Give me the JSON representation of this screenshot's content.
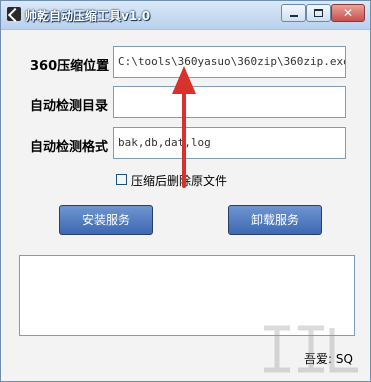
{
  "window": {
    "title": "帅乾自动压缩工具v1.0"
  },
  "titlebar": {
    "close_glyph": "✕"
  },
  "form": {
    "path_label": "360压缩位置",
    "path_value": "C:\\tools\\360yasuo\\360zip\\360zip.exe",
    "dir_label": "自动检测目录",
    "dir_value": "",
    "ext_label": "自动检测格式",
    "ext_value": "bak,db,dat,log",
    "delete_checkbox_label": "压缩后删除原文件",
    "delete_checked": false
  },
  "buttons": {
    "install_label": "安装服务",
    "uninstall_label": "卸载服务"
  },
  "log": {
    "content": ""
  },
  "footer": {
    "text": "吾爱: SQ"
  },
  "colors": {
    "button_blue": "#4a76bf",
    "annotation_arrow": "#d9312b"
  }
}
